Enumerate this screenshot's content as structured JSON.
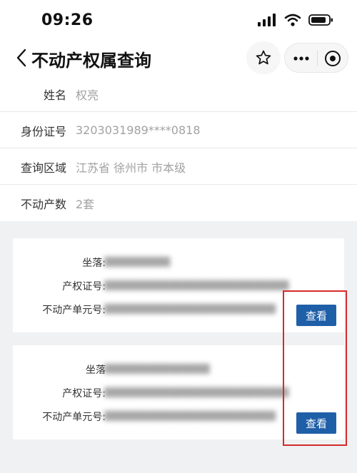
{
  "status_bar": {
    "time": "09:26",
    "icons": [
      "signal-icon",
      "wifi-icon",
      "battery-icon"
    ]
  },
  "nav": {
    "title": "不动产权属查询",
    "icons": [
      "back-icon",
      "star-icon",
      "more-icon",
      "target-icon"
    ]
  },
  "info": {
    "rows": [
      {
        "label": "姓名",
        "value": "权亮"
      },
      {
        "label": "身份证号",
        "value": "3203031989****0818"
      },
      {
        "label": "查询区域",
        "value": "江苏省 徐州市 市本级"
      },
      {
        "label": "不动产数",
        "value": "2套"
      }
    ]
  },
  "properties": [
    {
      "location_label": "坐落:",
      "location_value": "██████████",
      "cert_label": "产权证号:",
      "cert_value": "████████████████████████████",
      "unit_label": "不动产单元号:",
      "unit_value": "██████████████████████████",
      "button_label": "查看"
    },
    {
      "location_label": "坐落",
      "location_value": "████████████████",
      "cert_label": "产权证号:",
      "cert_value": "████████████████████████████",
      "unit_label": "不动产单元号:",
      "unit_value": "██████████████████████████",
      "button_label": "查看"
    }
  ],
  "colors": {
    "accent_button": "#1f5fa8",
    "highlight": "#d52a2a",
    "background": "#f0f1f3"
  }
}
